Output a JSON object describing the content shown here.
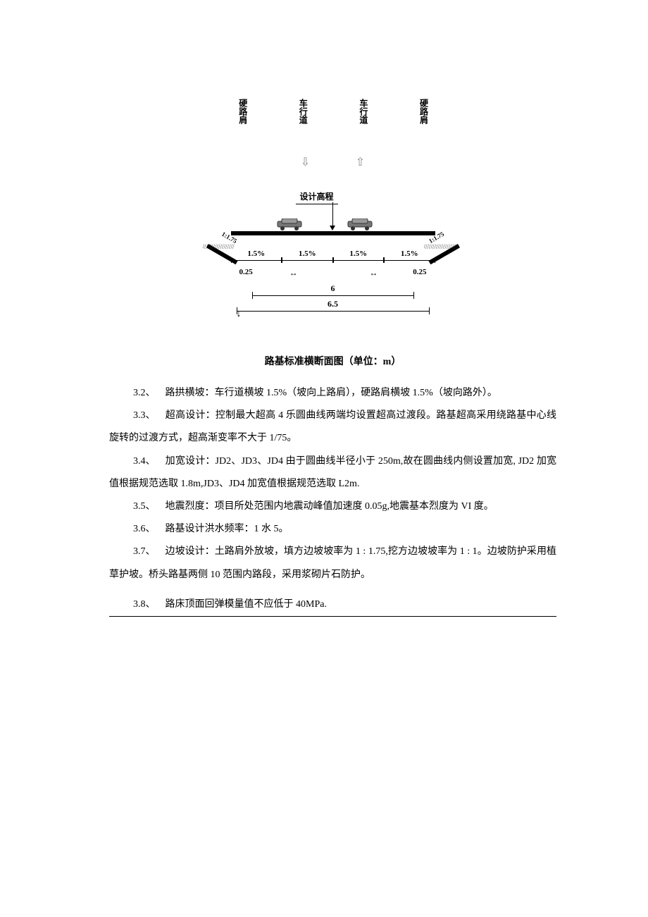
{
  "diagram": {
    "lane_labels": [
      "硬路肩",
      "车行道",
      "车行道",
      "硬路肩"
    ],
    "design_elev": "设计高程",
    "slope_ratio": "1:1.75",
    "cross_slopes": [
      "1.5%",
      "1.5%",
      "1.5%",
      "1.5%"
    ],
    "shoulder_width": "0.25",
    "lane_total": "6",
    "full_width": "6.5"
  },
  "caption": "路基标准横断面图（单位：m）",
  "items": [
    {
      "num": "3.2、",
      "text": "路拱横坡：车行道横坡 1.5%（坡向上路肩），硬路肩横坡 1.5%（坡向路外）。"
    },
    {
      "num": "3.3、",
      "text": "超高设计：控制最大超高 4 乐圆曲线两端均设置超高过渡段。路基超高采用绕路基中心线旋转的过渡方式，超高渐变率不大于 1/75。"
    },
    {
      "num": "3.4、",
      "text": "加宽设计：JD2、JD3、JD4 由于圆曲线半径小于 250m,故在圆曲线内侧设置加宽, JD2 加宽值根据规范选取 1.8m,JD3、JD4 加宽值根据规范选取 L2m."
    },
    {
      "num": "3.5、",
      "text": "地震烈度：项目所处范围内地震动峰值加速度 0.05g,地震基本烈度为 VI 度。"
    },
    {
      "num": "3.6、",
      "text": "路基设计洪水频率：1 水 5。"
    },
    {
      "num": "3.7、",
      "text": "边坡设计：土路肩外放坡，填方边坡坡率为 1 : 1.75,挖方边坡坡率为 1 : 1。边坡防护采用植草护坡。桥头路基两侧 10 范围内路段，采用浆砌片石防护。"
    },
    {
      "num": "3.8、",
      "text": "路床顶面回弹模量值不应低于 40MPa."
    }
  ]
}
